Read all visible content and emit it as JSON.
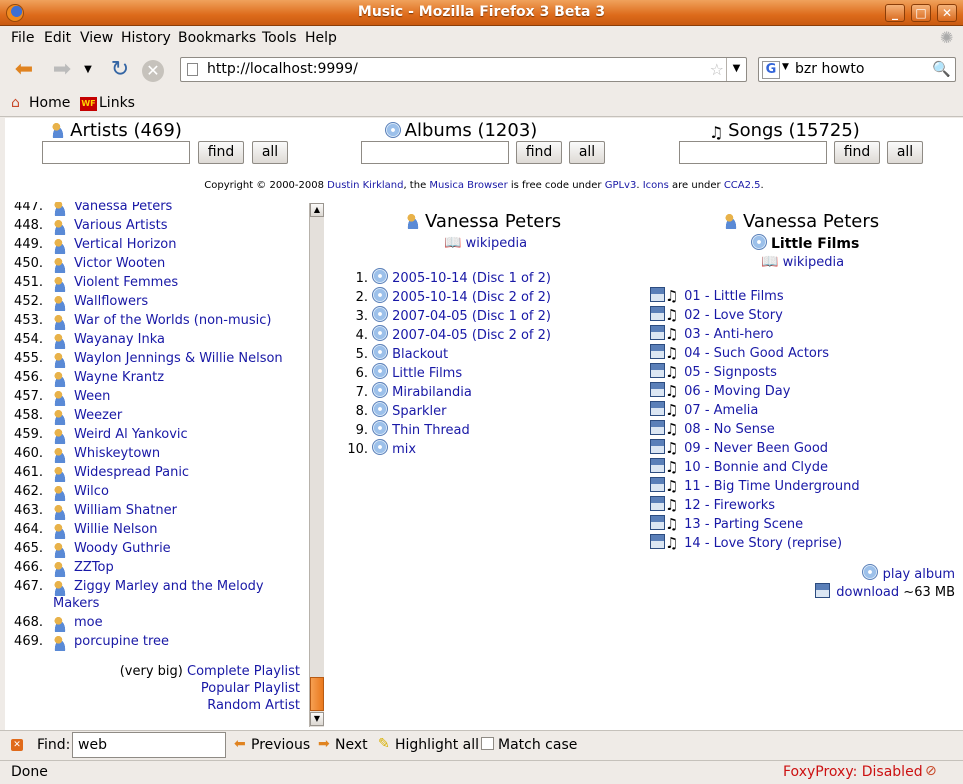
{
  "window": {
    "title": "Music - Mozilla Firefox 3 Beta 3"
  },
  "menu": [
    "File",
    "Edit",
    "View",
    "History",
    "Bookmarks",
    "Tools",
    "Help"
  ],
  "nav": {
    "url": "http://localhost:9999/",
    "search_engine": "G",
    "search_query": "bzr howto"
  },
  "bookmarks": [
    "Home",
    "Links"
  ],
  "search": {
    "artists": {
      "label": "Artists (469)",
      "find": "find",
      "all": "all"
    },
    "albums": {
      "label": "Albums (1203)",
      "find": "find",
      "all": "all"
    },
    "songs": {
      "label": "Songs (15725)",
      "find": "find",
      "all": "all"
    }
  },
  "copyright": {
    "prefix": "Copyright © 2000-2008 ",
    "author": "Dustin Kirkland",
    "mid1": ", the ",
    "project": "Musica Browser",
    "mid2": " is free code under ",
    "license": "GPLv3",
    "mid3": ". ",
    "icons": "Icons",
    "mid4": " are under ",
    "icons_license": "CCA2.5",
    "suffix": "."
  },
  "artists": [
    {
      "num": "447.",
      "name": "Vanessa Peters"
    },
    {
      "num": "448.",
      "name": "Various Artists"
    },
    {
      "num": "449.",
      "name": "Vertical Horizon"
    },
    {
      "num": "450.",
      "name": "Victor Wooten"
    },
    {
      "num": "451.",
      "name": "Violent Femmes"
    },
    {
      "num": "452.",
      "name": "Wallflowers"
    },
    {
      "num": "453.",
      "name": "War of the Worlds (non-music)"
    },
    {
      "num": "454.",
      "name": "Wayanay Inka"
    },
    {
      "num": "455.",
      "name": "Waylon Jennings & Willie Nelson"
    },
    {
      "num": "456.",
      "name": "Wayne Krantz"
    },
    {
      "num": "457.",
      "name": "Ween"
    },
    {
      "num": "458.",
      "name": "Weezer"
    },
    {
      "num": "459.",
      "name": "Weird Al Yankovic"
    },
    {
      "num": "460.",
      "name": "Whiskeytown"
    },
    {
      "num": "461.",
      "name": "Widespread Panic"
    },
    {
      "num": "462.",
      "name": "Wilco"
    },
    {
      "num": "463.",
      "name": "William Shatner"
    },
    {
      "num": "464.",
      "name": "Willie Nelson"
    },
    {
      "num": "465.",
      "name": "Woody Guthrie"
    },
    {
      "num": "466.",
      "name": "ZZTop"
    },
    {
      "num": "467.",
      "name": "Ziggy Marley and the Melody",
      "name2": "Makers"
    },
    {
      "num": "468.",
      "name": "moe"
    },
    {
      "num": "469.",
      "name": "porcupine tree"
    }
  ],
  "playlists": {
    "note": "(very big)",
    "complete": "Complete Playlist",
    "popular": "Popular Playlist",
    "random": "Random Artist"
  },
  "album_pane": {
    "artist": "Vanessa Peters",
    "wiki": "wikipedia",
    "albums": [
      {
        "num": "1.",
        "title": "2005-10-14 (Disc 1 of 2)"
      },
      {
        "num": "2.",
        "title": "2005-10-14 (Disc 2 of 2)"
      },
      {
        "num": "3.",
        "title": "2007-04-05 (Disc 1 of 2)"
      },
      {
        "num": "4.",
        "title": "2007-04-05 (Disc 2 of 2)"
      },
      {
        "num": "5.",
        "title": "Blackout"
      },
      {
        "num": "6.",
        "title": "Little Films"
      },
      {
        "num": "7.",
        "title": "Mirabilandia"
      },
      {
        "num": "8.",
        "title": "Sparkler"
      },
      {
        "num": "9.",
        "title": "Thin Thread"
      },
      {
        "num": "10.",
        "title": "mix"
      }
    ]
  },
  "song_pane": {
    "artist": "Vanessa Peters",
    "album": "Little Films",
    "wiki": "wikipedia",
    "songs": [
      "01 - Little Films",
      "02 - Love Story",
      "03 - Anti-hero",
      "04 - Such Good Actors",
      "05 - Signposts",
      "06 - Moving Day",
      "07 - Amelia",
      "08 - No Sense",
      "09 - Never Been Good",
      "10 - Bonnie and Clyde",
      "11 - Big Time Underground",
      "12 - Fireworks",
      "13 - Parting Scene",
      "14 - Love Story (reprise)"
    ],
    "play_album": "play album",
    "download": "download",
    "size": "~63 MB"
  },
  "findbar": {
    "label": "Find:",
    "value": "web",
    "previous": "Previous",
    "next": "Next",
    "highlight": "Highlight all",
    "match_case": "Match case"
  },
  "status": {
    "text": "Done",
    "proxy": "FoxyProxy: Disabled"
  },
  "colors": {
    "link": "#1818a6",
    "titlebar": "#dd6b1b",
    "proxy": "#cc1111"
  }
}
